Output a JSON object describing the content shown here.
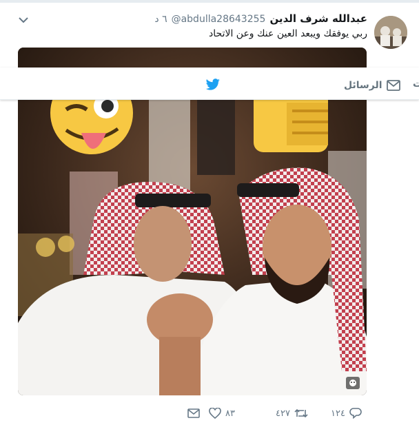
{
  "tweet": {
    "author_name": "عبدالله شرف الدين",
    "handle": "@abdulla28643255",
    "time": "٦ د",
    "text": "ربي يوفقك ويبعد العين عنك وعن الاتحاد"
  },
  "nav": {
    "messages_label": "الرسائل",
    "cut_label": "ت"
  },
  "actions": {
    "reply_count": "١٢٤",
    "retweet_count": "٤٢٧",
    "like_count": "٨٣"
  },
  "icons": {
    "chevron": "chevron-down-icon",
    "twitter": "twitter-bird-icon",
    "messages": "envelope-icon",
    "reply": "reply-icon",
    "retweet": "retweet-icon",
    "like": "heart-icon",
    "dm": "direct-message-icon",
    "media_badge": "face-badge-icon"
  },
  "colors": {
    "twitter_blue": "#1da1f2",
    "text_secondary": "#657786",
    "emoji_yellow": "#f7c843"
  }
}
